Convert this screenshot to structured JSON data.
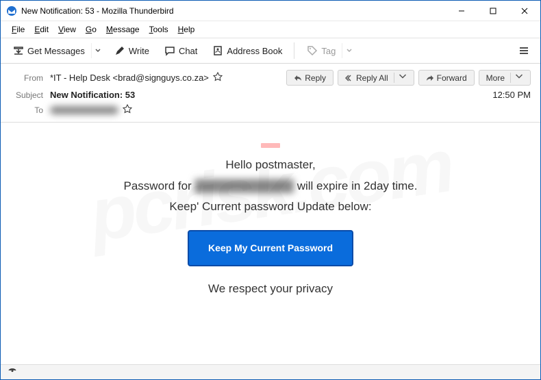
{
  "window": {
    "title": "New Notification: 53 - Mozilla Thunderbird"
  },
  "menu": {
    "file": "File",
    "edit": "Edit",
    "view": "View",
    "go": "Go",
    "message": "Message",
    "tools": "Tools",
    "help": "Help"
  },
  "toolbar": {
    "get_messages": "Get Messages",
    "write": "Write",
    "chat": "Chat",
    "address_book": "Address Book",
    "tag": "Tag"
  },
  "header": {
    "from_label": "From",
    "from_value": "*IT - Help Desk <brad@signguys.co.za>",
    "subject_label": "Subject",
    "subject_value": "New Notification: 53",
    "to_label": "To",
    "time": "12:50 PM",
    "actions": {
      "reply": "Reply",
      "reply_all": "Reply All",
      "forward": "Forward",
      "more": "More"
    }
  },
  "body": {
    "greeting": "Hello postmaster,",
    "line1_pre": "Password for ",
    "line1_post": " will expire in 2day time.",
    "line2": "Keep' Current password Update below:",
    "cta": "Keep My Current Password",
    "footer": "We respect your privacy"
  },
  "watermark": "pcrisk.com"
}
